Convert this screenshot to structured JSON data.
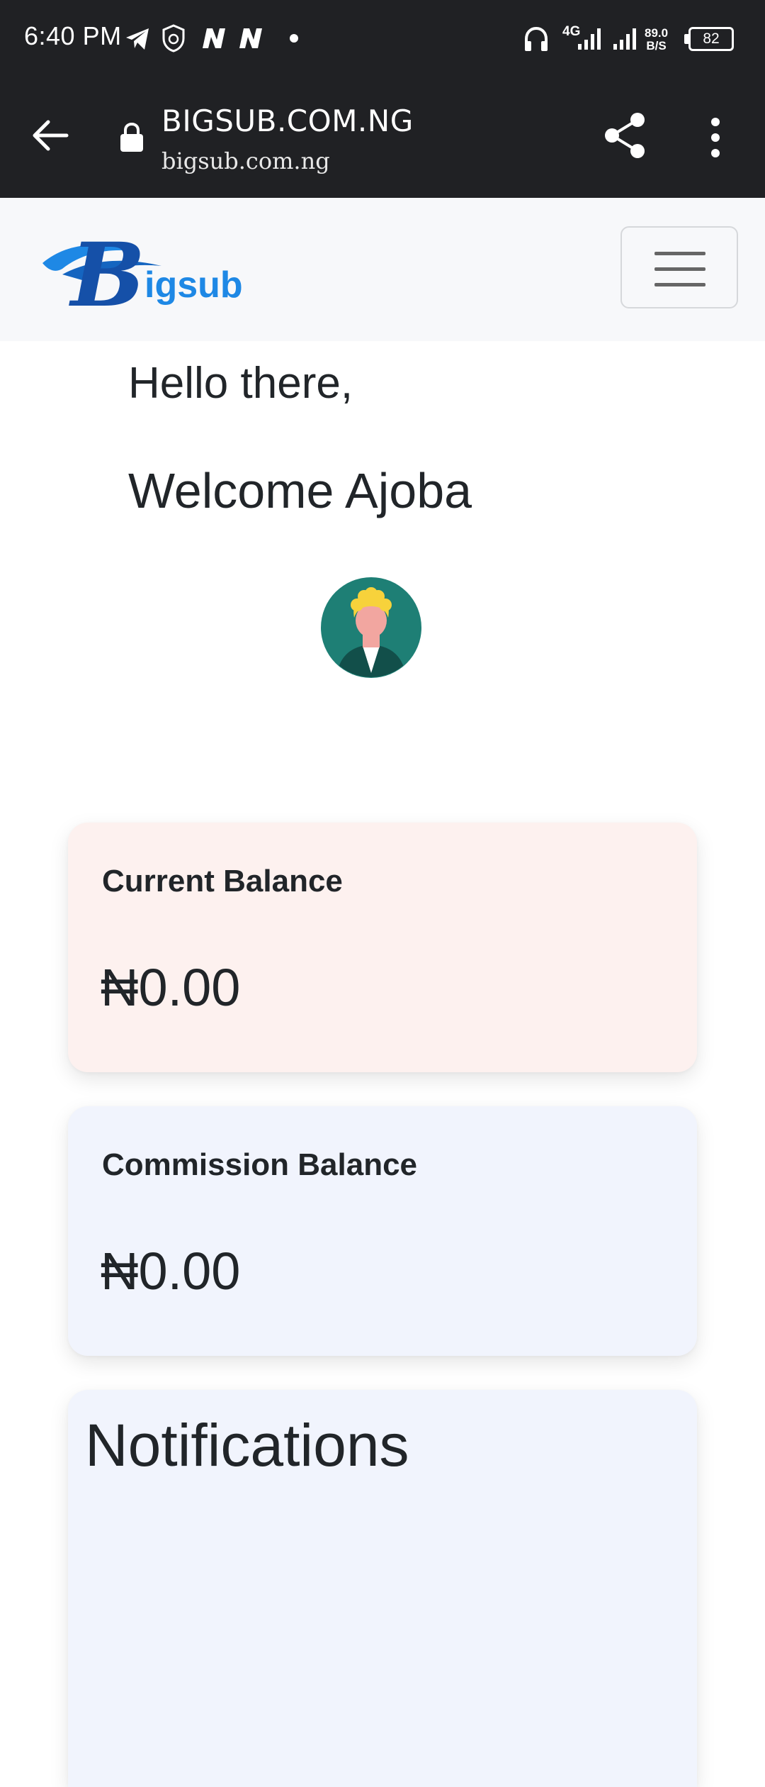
{
  "status_bar": {
    "time": "6:40 PM",
    "network_label": "4G",
    "net_speed_value": "89.0",
    "net_speed_unit": "B/S",
    "battery_level": "82",
    "icons": [
      "telegram-icon",
      "shield-icon",
      "n-app-icon",
      "n-app-icon",
      "dot-icon",
      "headphones-icon",
      "signal-icon",
      "signal-icon",
      "battery-icon"
    ]
  },
  "browser": {
    "page_title": "BIGSUB.COM.NG",
    "url": "bigsub.com.ng",
    "icons": [
      "back-arrow-icon",
      "lock-icon",
      "share-icon",
      "more-vert-icon"
    ]
  },
  "navbar": {
    "logo_text": "igsub",
    "logo_initial": "B",
    "brand_color": "#1565c0",
    "accent_color": "#1e88e5"
  },
  "greeting": {
    "hello": "Hello there,",
    "welcome": "Welcome Ajoba"
  },
  "balances": {
    "current": {
      "label": "Current Balance",
      "value": "₦0.00",
      "bg": "#fdf1ef"
    },
    "commission": {
      "label": "Commission Balance",
      "value": "₦0.00",
      "bg": "#f1f4fd"
    }
  },
  "notifications": {
    "title": "Notifications",
    "bg": "#f1f4fd"
  }
}
